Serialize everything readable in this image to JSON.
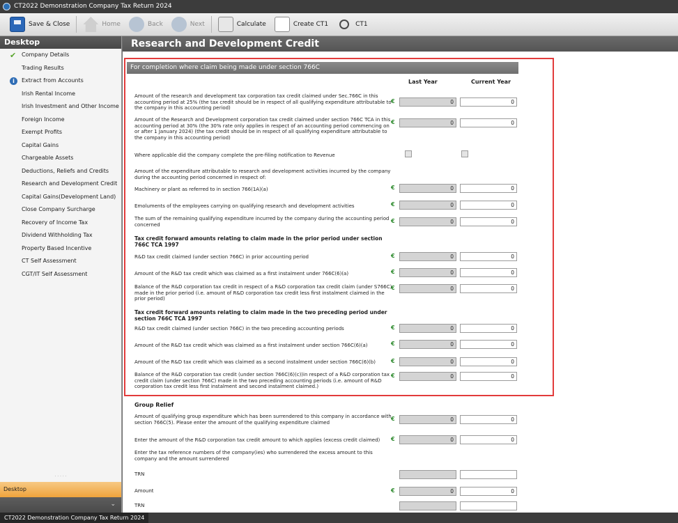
{
  "window": {
    "title": "CT2022 Demonstration Company Tax Return 2024"
  },
  "toolbar": {
    "save_close": "Save & Close",
    "home": "Home",
    "back": "Back",
    "next": "Next",
    "calculate": "Calculate",
    "create_ct1": "Create CT1",
    "ct1": "CT1"
  },
  "sidebar": {
    "header": "Desktop",
    "items": [
      {
        "label": "Company Details",
        "mark": "check"
      },
      {
        "label": "Trading Results",
        "mark": ""
      },
      {
        "label": "Extract from Accounts",
        "mark": "info"
      },
      {
        "label": "Irish Rental Income",
        "mark": ""
      },
      {
        "label": "Irish Investment and Other Income",
        "mark": ""
      },
      {
        "label": "Foreign Income",
        "mark": ""
      },
      {
        "label": "Exempt Profits",
        "mark": ""
      },
      {
        "label": "Capital Gains",
        "mark": ""
      },
      {
        "label": "Chargeable Assets",
        "mark": ""
      },
      {
        "label": "Deductions, Reliefs and Credits",
        "mark": ""
      },
      {
        "label": "Research and Development Credit",
        "mark": ""
      },
      {
        "label": "Capital Gains(Development Land)",
        "mark": ""
      },
      {
        "label": "Close Company Surcharge",
        "mark": ""
      },
      {
        "label": "Recovery of Income Tax",
        "mark": ""
      },
      {
        "label": "Dividend Withholding Tax",
        "mark": ""
      },
      {
        "label": "Property Based Incentive",
        "mark": ""
      },
      {
        "label": "CT Self Assessment",
        "mark": ""
      },
      {
        "label": "CGT/IT Self Assessment",
        "mark": ""
      }
    ],
    "footer": "Desktop"
  },
  "main": {
    "title": "Research and Development Credit",
    "section_title": "For completion where claim being made under section 766C",
    "col_last": "Last Year",
    "col_current": "Current Year",
    "currency": "€",
    "rows": [
      {
        "label": "Amount of the research and development tax corporation tax credit claimed under Sec.766C in this accounting period at 25% (the tax credit should be in respect of all qualifying expenditure attributable to the company in this accounting period)",
        "last": "0",
        "current": "0"
      },
      {
        "label": "Amount of the Research and Development corporation tax credit claimed under section 766C TCA in this accounting period at 30% (the 30% rate only applies in respect of an accounting period commencing on or after 1 January 2024) (the tax credit should be in respect of all qualifying expenditure attributable to the company in this accounting period)",
        "last": "0",
        "current": "0"
      },
      {
        "label": "Where applicable did the company complete the pre-filing notification to Revenue"
      },
      {
        "label": "Amount of the expenditure attributable to research and development activities incurred by the company during the accounting period concerned in respect of:"
      },
      {
        "label": "Machinery or plant as referred to in section 766(1A)(a)",
        "last": "0",
        "current": "0"
      },
      {
        "label": "Emoluments of the employees carrying on qualifying research and development activities",
        "last": "0",
        "current": "0"
      },
      {
        "label": "The sum of the remaining qualifying expenditure incurred by the company during the accounting period concerned",
        "last": "0",
        "current": "0"
      },
      {
        "label": "Tax credit forward amounts relating to claim made in the prior period under section 766C TCA 1997"
      },
      {
        "label": "R&D tax credit claimed (under section 766C) in prior accounting period",
        "last": "0",
        "current": "0"
      },
      {
        "label": "Amount of the R&D tax credit which was claimed as a first instalment under 766C(6)(a)",
        "last": "0",
        "current": "0"
      },
      {
        "label": "Balance of the R&D corporation tax credit in respect of a R&D corporation tax credit claim (under S766C) made in the prior period (i.e. amount of R&D corporation tax credit less first instalment claimed in the prior period)",
        "last": "0",
        "current": "0"
      },
      {
        "label": "Tax credit forward amounts relating to claim made in the two preceding period under section 766C TCA 1997"
      },
      {
        "label": "R&D tax credit claimed (under section 766C) in the two preceding accounting periods",
        "last": "0",
        "current": "0"
      },
      {
        "label": "Amount of the R&D tax credit which was claimed as a first instalment under section 766C(6)(a)",
        "last": "0",
        "current": "0"
      },
      {
        "label": "Amount of the R&D tax credit which was claimed as a second instalment under section 766C(6)(b)",
        "last": "0",
        "current": "0"
      },
      {
        "label": "Balance of the R&D corporation tax credit (under section 766C(6)(c))in respect of a R&D corporation tax credit claim (under section 766C) made in the two preceding accounting periods (i.e. amount of R&D corporation tax credit less first instalment and second instalment claimed.)",
        "last": "0",
        "current": "0"
      }
    ],
    "group_relief": {
      "title": "Group Relief",
      "rows": [
        {
          "label": "Amount of qualifying group expenditure which has been surrendered to this company in accordance with section 766C(5). Please enter the amount of the qualifying expenditure claimed",
          "last": "0",
          "current": "0"
        },
        {
          "label": "Enter the amount of the R&D corporation tax credit amount to which applies (excess credit claimed)",
          "last": "0",
          "current": "0"
        },
        {
          "label": "Enter the tax reference numbers of the company(ies) who surrendered the excess amount to this company and the amount surrendered"
        },
        {
          "label": "TRN",
          "last": "",
          "current": ""
        },
        {
          "label": "Amount",
          "last": "0",
          "current": "0"
        },
        {
          "label": "TRN",
          "last": "",
          "current": ""
        }
      ]
    }
  },
  "statusbar": {
    "tab": "CT2022 Demonstration Company Tax Return 2024"
  }
}
